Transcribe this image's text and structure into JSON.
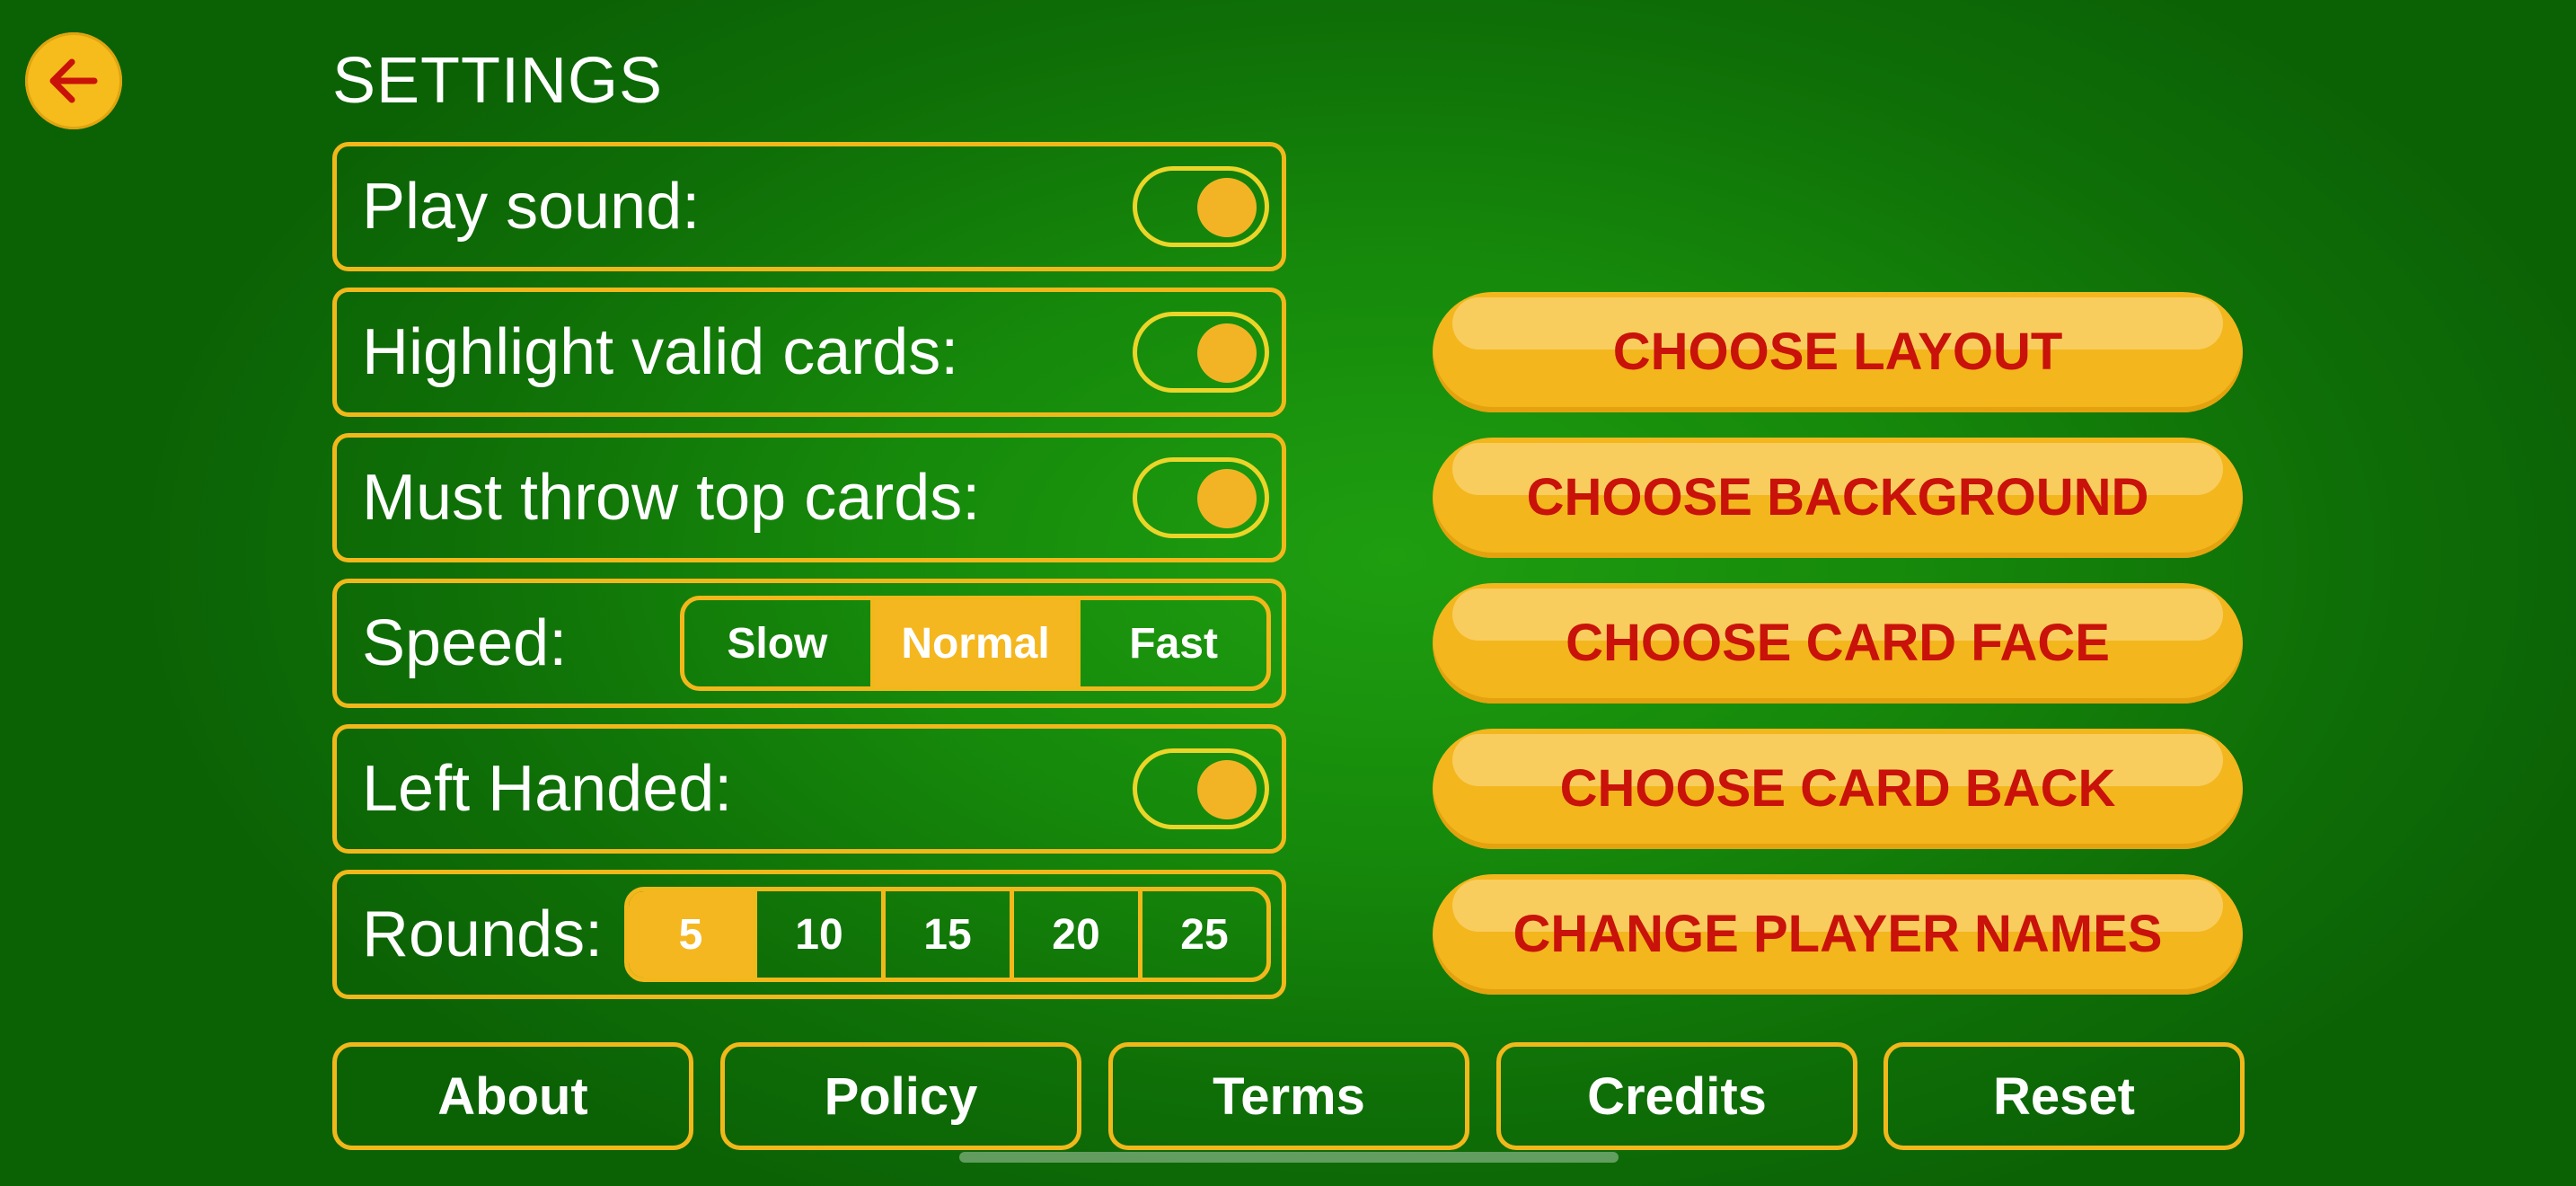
{
  "colors": {
    "accent": "#f3b61d",
    "button_text": "#c8120a",
    "background": "#168a0b"
  },
  "header": {
    "title": "SETTINGS",
    "back_icon": "arrow-left-icon"
  },
  "settings": {
    "play_sound": {
      "label": "Play sound:",
      "on": true
    },
    "highlight_valid_cards": {
      "label": "Highlight valid cards:",
      "on": true
    },
    "must_throw_top_cards": {
      "label": "Must throw top cards:",
      "on": true
    },
    "speed": {
      "label": "Speed:",
      "options": [
        "Slow",
        "Normal",
        "Fast"
      ],
      "selected": "Normal"
    },
    "left_handed": {
      "label": "Left Handed:",
      "on": true
    },
    "rounds": {
      "label": "Rounds:",
      "options": [
        "5",
        "10",
        "15",
        "20",
        "25"
      ],
      "selected": "5"
    }
  },
  "actions": {
    "choose_layout": "CHOOSE LAYOUT",
    "choose_background": "CHOOSE BACKGROUND",
    "choose_card_face": "CHOOSE CARD FACE",
    "choose_card_back": "CHOOSE CARD BACK",
    "change_player_names": "CHANGE PLAYER NAMES"
  },
  "footer": {
    "about": "About",
    "policy": "Policy",
    "terms": "Terms",
    "credits": "Credits",
    "reset": "Reset"
  }
}
